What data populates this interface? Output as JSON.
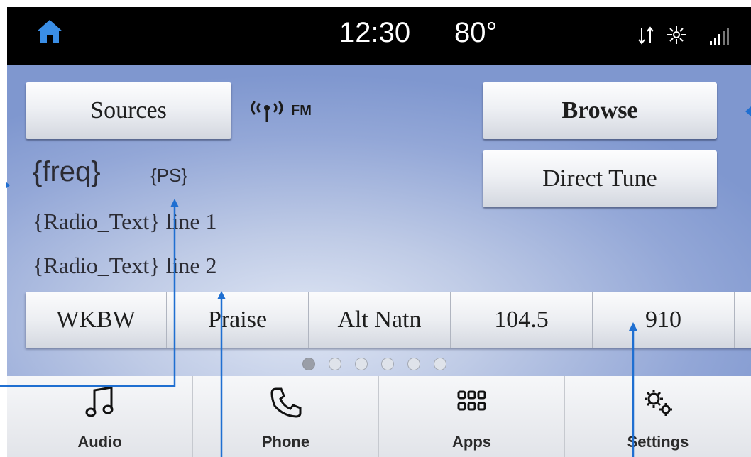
{
  "status_bar": {
    "time": "12:30",
    "temperature": "80°",
    "icons": [
      "home-icon",
      "sync-icon",
      "climate-icon",
      "signal-icon"
    ]
  },
  "source_panel": {
    "sources_label": "Sources",
    "band": "FM",
    "band_icon": "antenna-icon"
  },
  "right_buttons": {
    "browse_label": "Browse",
    "direct_tune_label": "Direct Tune"
  },
  "station_info": {
    "freq": "{freq}",
    "ps": "{PS}",
    "radio_text_line1": "{Radio_Text} line 1",
    "radio_text_line2": "{Radio_Text} line 2"
  },
  "presets": [
    "WKBW",
    "Praise",
    "Alt Natn",
    "104.5",
    "910"
  ],
  "preset_pages": {
    "count": 6,
    "active_index": 0
  },
  "nav": [
    {
      "label": "Audio",
      "icon": "music-note-icon"
    },
    {
      "label": "Phone",
      "icon": "phone-icon"
    },
    {
      "label": "Apps",
      "icon": "apps-grid-icon"
    },
    {
      "label": "Settings",
      "icon": "gears-icon"
    }
  ],
  "colors": {
    "status_bar_bg": "#000000",
    "home_icon": "#3a8ee6",
    "annotation_line": "#1f6fd1",
    "screen_bg": "#93a7d7"
  }
}
